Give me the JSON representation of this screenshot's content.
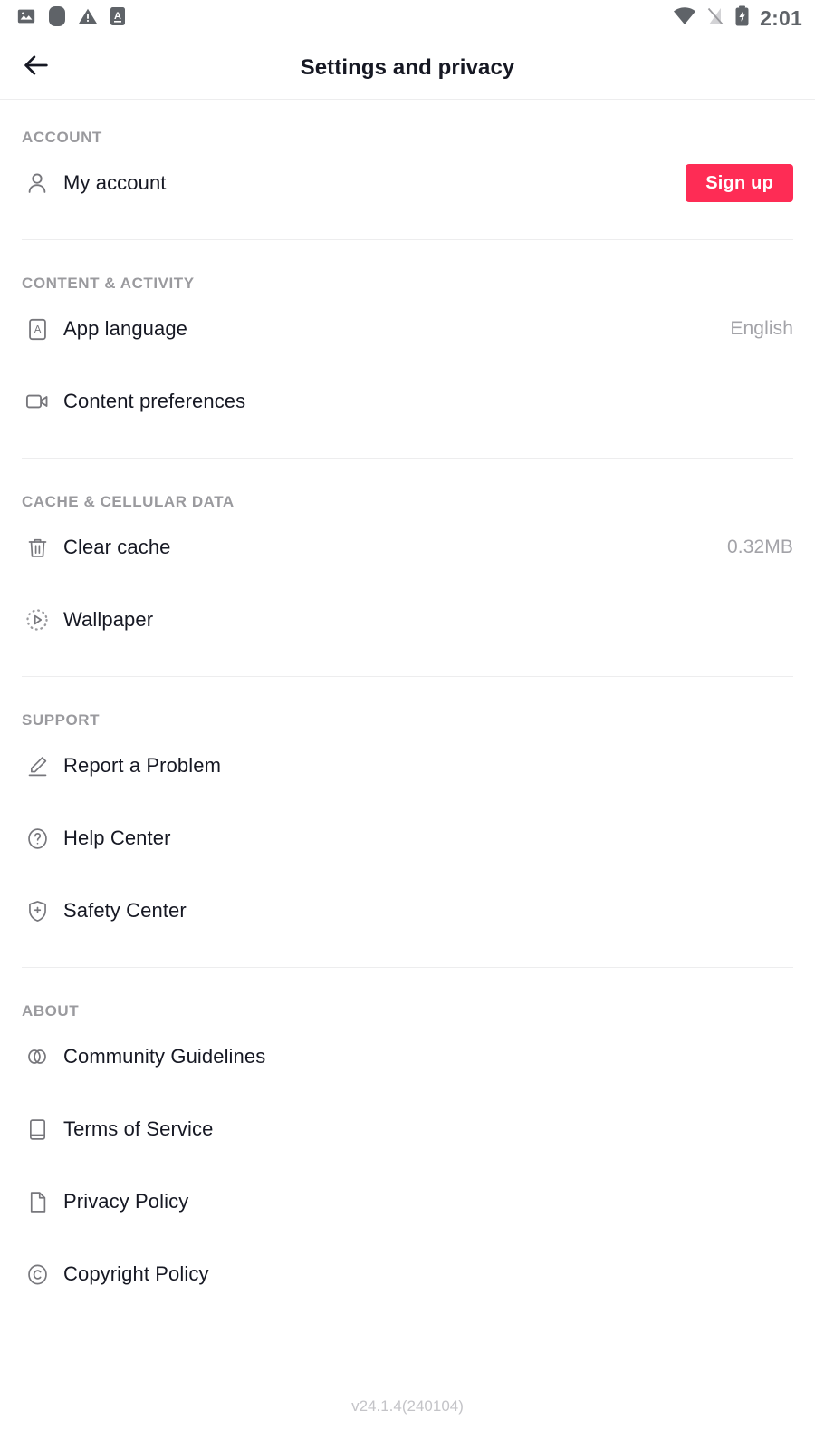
{
  "statusbar": {
    "time": "2:01",
    "left_icons": [
      "image-icon",
      "rounded-square-icon",
      "warning-icon",
      "a-badge-icon"
    ],
    "right_icons": [
      "wifi-icon",
      "signal-off-icon",
      "battery-charging-icon"
    ]
  },
  "header": {
    "title": "Settings and privacy",
    "back_icon": "back-arrow-icon"
  },
  "colors": {
    "accent": "#FE2C55",
    "text": "#161823",
    "muted": "#9a9a9e",
    "value": "#a3a3a8",
    "divider": "#ededee",
    "icon": "#77777c"
  },
  "sections": [
    {
      "title": "ACCOUNT",
      "items": [
        {
          "label": "My account",
          "icon": "person-icon",
          "value": "",
          "button": "Sign up"
        }
      ]
    },
    {
      "title": "CONTENT & ACTIVITY",
      "items": [
        {
          "label": "App language",
          "icon": "language-a-icon",
          "value": "English"
        },
        {
          "label": "Content preferences",
          "icon": "video-camera-icon",
          "value": ""
        }
      ]
    },
    {
      "title": "CACHE & CELLULAR DATA",
      "items": [
        {
          "label": "Clear cache",
          "icon": "trash-icon",
          "value": "0.32MB"
        },
        {
          "label": "Wallpaper",
          "icon": "wallpaper-play-icon",
          "value": ""
        }
      ]
    },
    {
      "title": "SUPPORT",
      "items": [
        {
          "label": "Report a Problem",
          "icon": "pencil-icon",
          "value": ""
        },
        {
          "label": "Help Center",
          "icon": "question-circle-icon",
          "value": ""
        },
        {
          "label": "Safety Center",
          "icon": "shield-plus-icon",
          "value": ""
        }
      ]
    },
    {
      "title": "ABOUT",
      "items": [
        {
          "label": "Community Guidelines",
          "icon": "two-circles-icon",
          "value": ""
        },
        {
          "label": "Terms of Service",
          "icon": "book-icon",
          "value": ""
        },
        {
          "label": "Privacy Policy",
          "icon": "document-icon",
          "value": ""
        },
        {
          "label": "Copyright Policy",
          "icon": "copyright-icon",
          "value": ""
        }
      ]
    }
  ],
  "footer": {
    "version": "v24.1.4(240104)"
  }
}
